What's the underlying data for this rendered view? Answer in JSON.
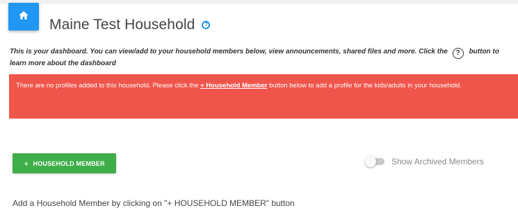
{
  "header": {
    "title": "Maine Test Household",
    "home_icon": "home-icon",
    "help_icon": "help-circle-icon",
    "home_color": "#2196f3"
  },
  "dashboard": {
    "intro_part1": "This is your dashboard. You can view/add to your household members below, view announcements, shared files and more. Click the",
    "intro_icon": "?",
    "intro_part2": "button to learn more about the dashboard"
  },
  "alert": {
    "text_before": "There are no profiles added to this household. Please click the",
    "link": "+ Household Member",
    "text_after": "button below to add a profile for the kids/adults in your household.",
    "color": "#f0554b"
  },
  "actions": {
    "add_plus": "+",
    "add_label": "HOUSEHOLD MEMBER",
    "add_color": "#3fae49",
    "archived_label": "Show Archived Members",
    "archived_on": false
  },
  "hint": "Add a Household Member by clicking on \"+ HOUSEHOLD MEMBER\" button"
}
